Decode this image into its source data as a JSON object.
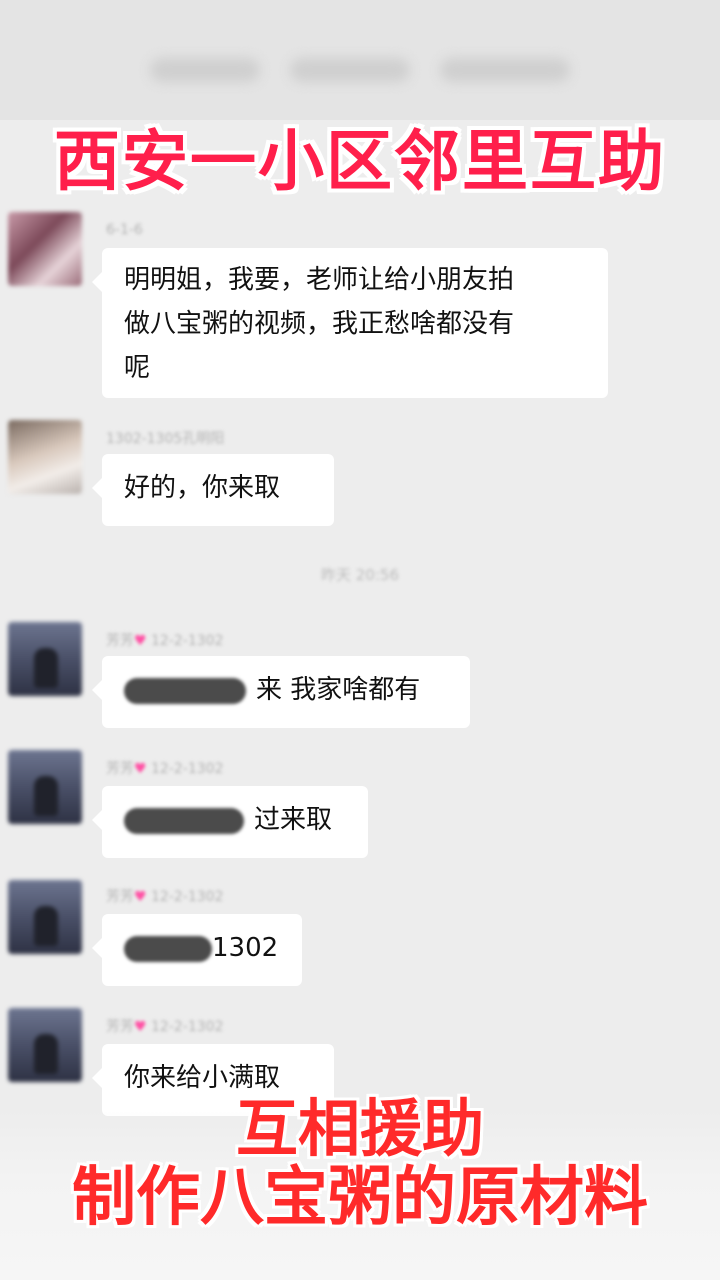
{
  "overlay": {
    "title": "西安一小区邻里互助",
    "caption_line1": "互相援助",
    "caption_line2": "制作八宝粥的原材料"
  },
  "chat": {
    "timestamp": "昨天 20:56",
    "messages": [
      {
        "avatar": "avatar-1",
        "sender": "6-1-6",
        "text": "明明姐，我要，老师让给小朋友拍做八宝粥的视频，我正愁啥都没有呢",
        "lines": [
          "明明姐，我要，老师让给小朋友拍",
          "做八宝粥的视频，我正愁啥都没有",
          "呢"
        ]
      },
      {
        "avatar": "avatar-2",
        "sender": "1302-1305孔明阳",
        "text": "好的，你来取"
      },
      {
        "avatar": "avatar-3",
        "sender": "芳芳",
        "sender_suffix": "12-2-1302",
        "text": "来 我家啥都有"
      },
      {
        "avatar": "avatar-3",
        "sender": "芳芳",
        "sender_suffix": "12-2-1302",
        "text": "过来取"
      },
      {
        "avatar": "avatar-3",
        "sender": "芳芳",
        "sender_suffix": "12-2-1302",
        "text": "1302"
      },
      {
        "avatar": "avatar-3",
        "sender": "芳芳",
        "sender_suffix": "12-2-1302",
        "text": "你来给小满取"
      }
    ]
  },
  "colors": {
    "background": "#ededed",
    "bubble": "#ffffff",
    "title_red": "#ff1f4b",
    "caption_red": "#ff2a2a"
  }
}
